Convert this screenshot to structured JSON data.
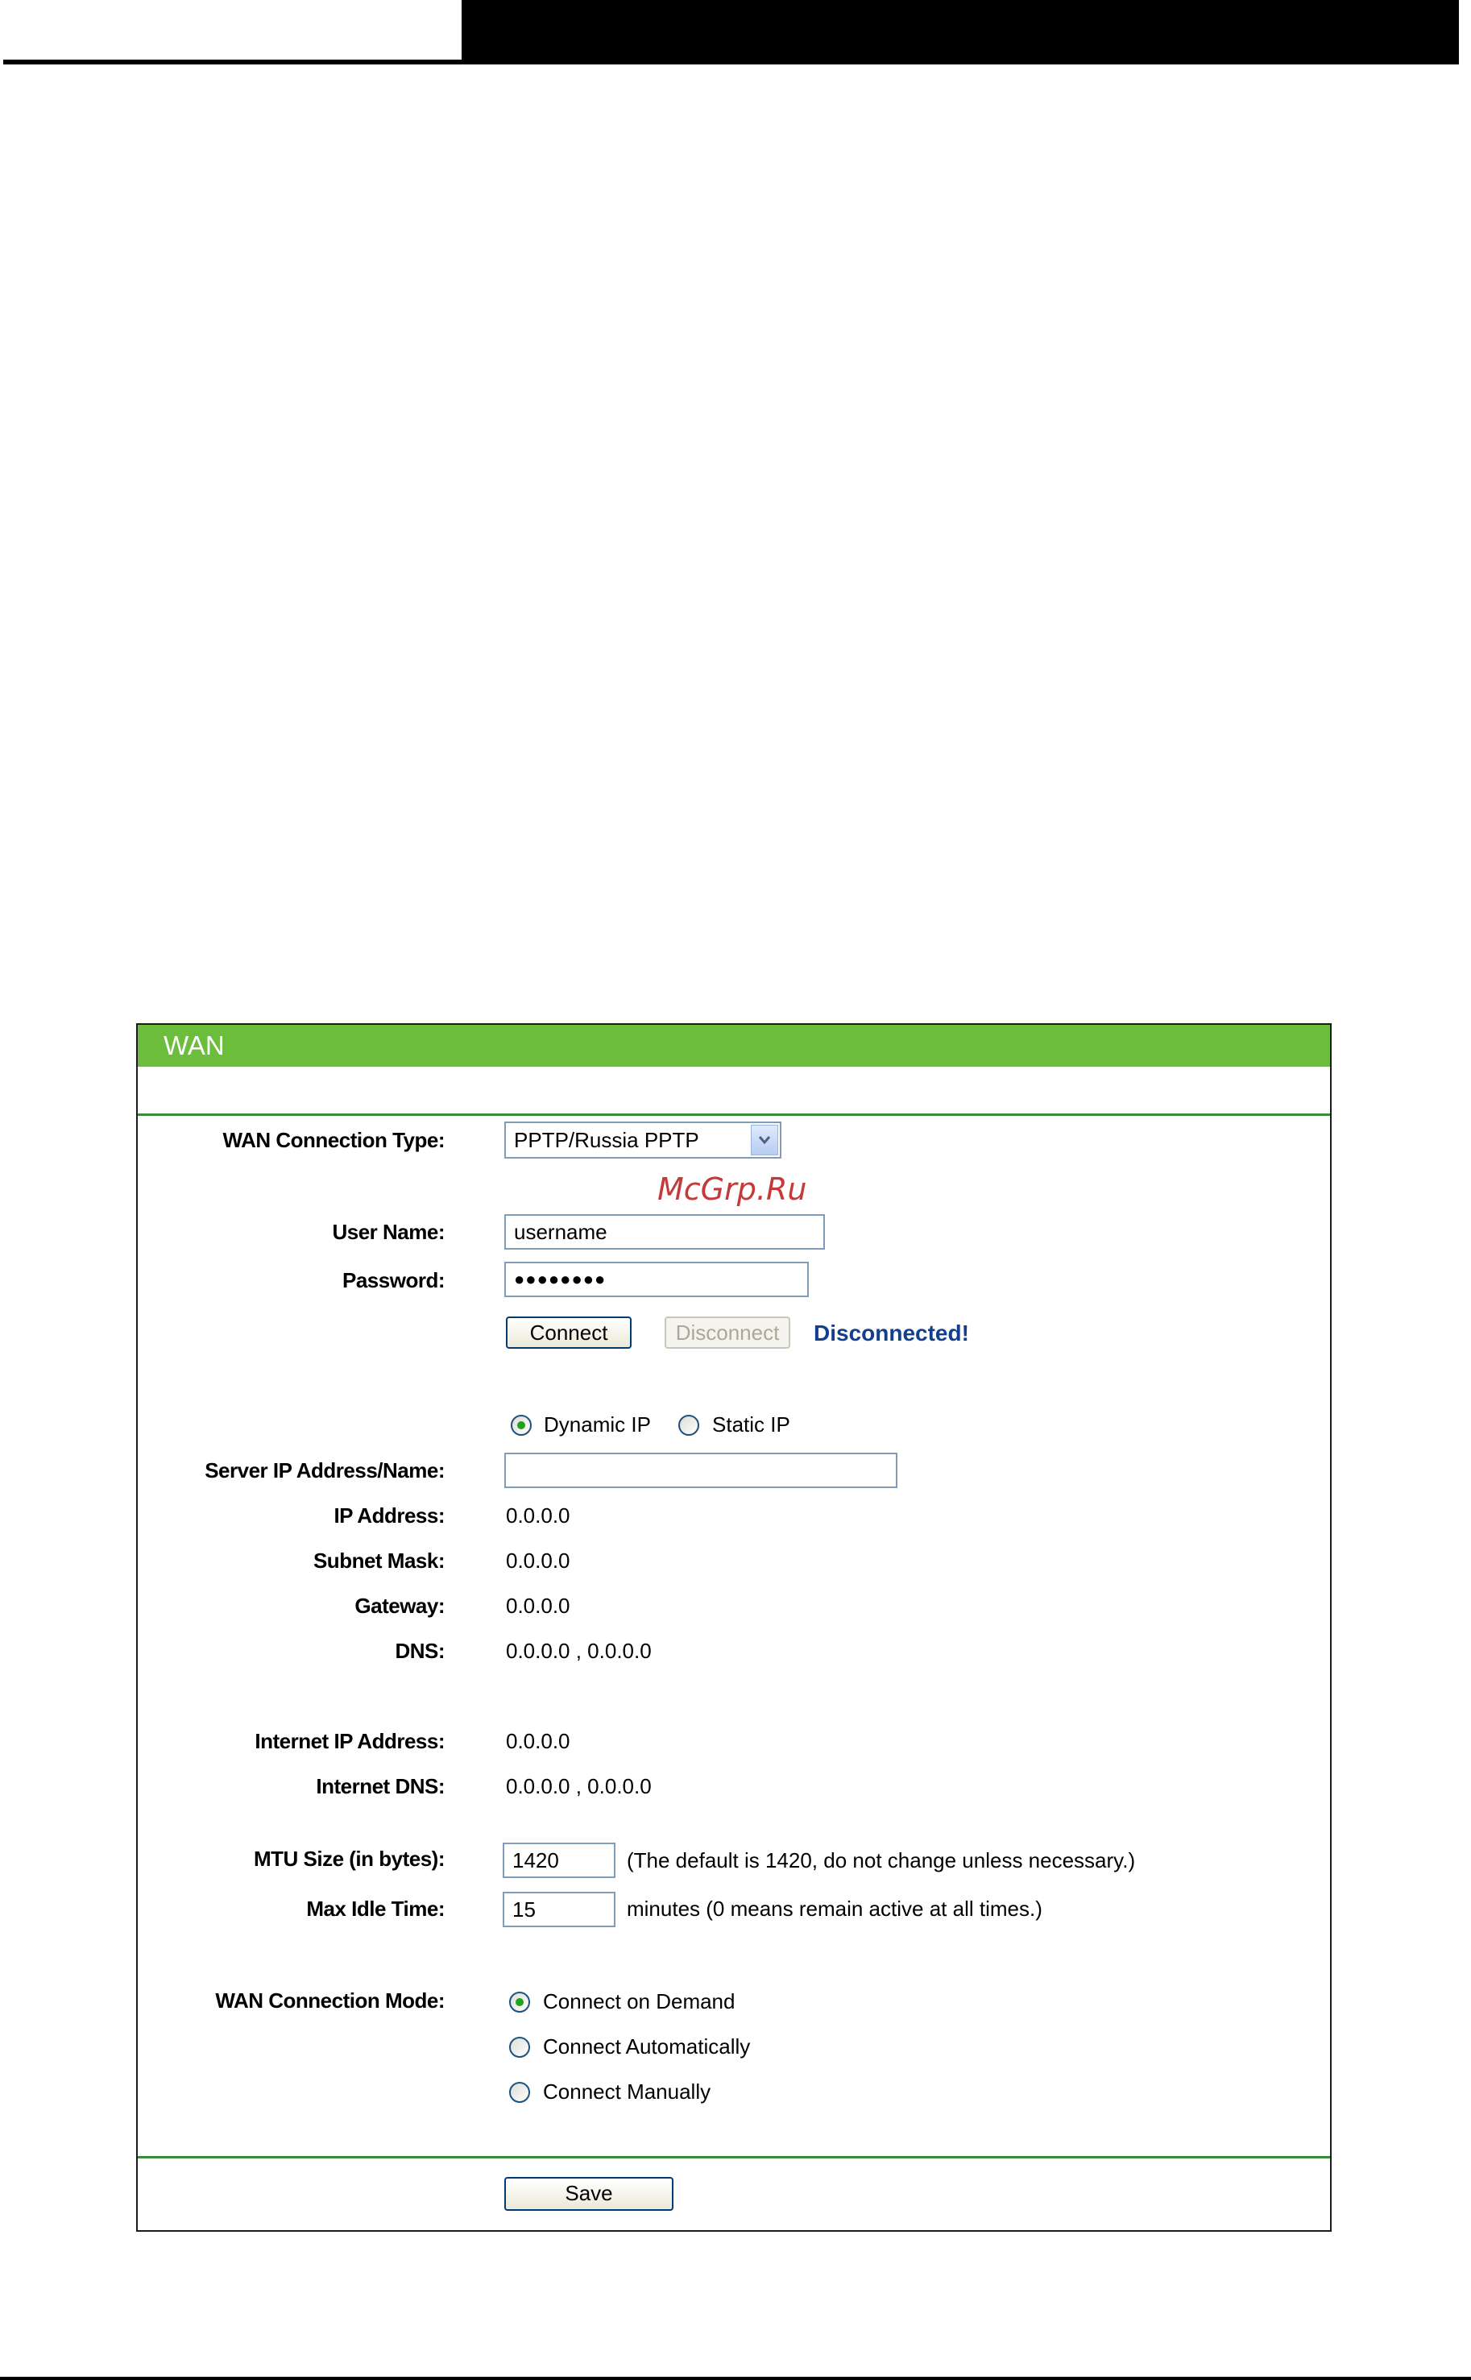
{
  "panel": {
    "title": "WAN"
  },
  "watermark": "McGrp.Ru",
  "form": {
    "wan_connection_type": {
      "label": "WAN Connection Type:",
      "value": "PPTP/Russia PPTP"
    },
    "user_name": {
      "label": "User Name:",
      "value": "username"
    },
    "password": {
      "label": "Password:",
      "masked": "●●●●●●●●"
    },
    "connect_button": "Connect",
    "disconnect_button": "Disconnect",
    "status": "Disconnected!",
    "ip_mode": {
      "dynamic_label": "Dynamic IP",
      "static_label": "Static IP",
      "selected": "Dynamic IP"
    },
    "server_ip": {
      "label": "Server IP Address/Name:",
      "value": ""
    },
    "ip_address": {
      "label": "IP Address:",
      "value": "0.0.0.0"
    },
    "subnet_mask": {
      "label": "Subnet Mask:",
      "value": "0.0.0.0"
    },
    "gateway": {
      "label": "Gateway:",
      "value": "0.0.0.0"
    },
    "dns": {
      "label": "DNS:",
      "value": "0.0.0.0 , 0.0.0.0"
    },
    "internet_ip": {
      "label": "Internet IP Address:",
      "value": "0.0.0.0"
    },
    "internet_dns": {
      "label": "Internet DNS:",
      "value": "0.0.0.0 , 0.0.0.0"
    },
    "mtu": {
      "label": "MTU Size (in bytes):",
      "value": "1420",
      "hint": "(The default is 1420, do not change unless necessary.)"
    },
    "max_idle": {
      "label": "Max Idle Time:",
      "value": "15",
      "hint": "minutes (0 means remain active at all times.)"
    },
    "wan_mode": {
      "label": "WAN Connection Mode:",
      "options": [
        "Connect on Demand",
        "Connect Automatically",
        "Connect Manually"
      ],
      "selected": "Connect on Demand"
    },
    "save_button": "Save"
  },
  "colors": {
    "title_bar": "#6cbd3c",
    "status": "#133f8f",
    "watermark": "#c43a3a"
  }
}
